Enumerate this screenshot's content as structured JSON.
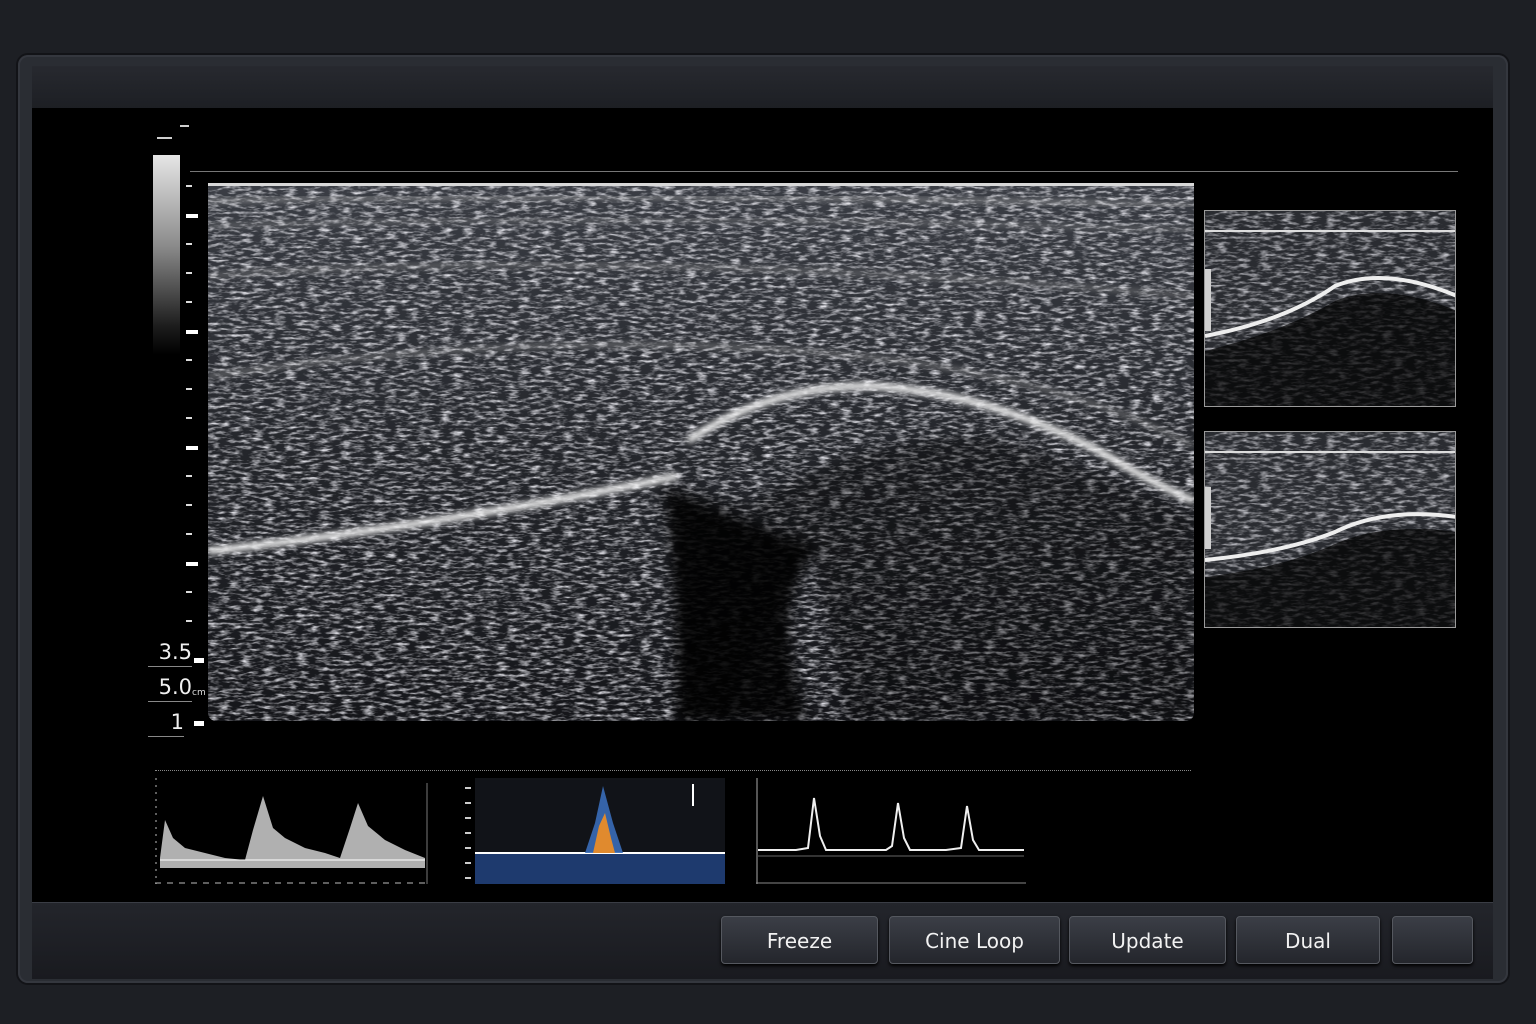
{
  "depth_params": [
    {
      "value": "3.5"
    },
    {
      "value": "5.0",
      "unit": "cm"
    },
    {
      "value": "1"
    }
  ],
  "buttons": {
    "freeze": "Freeze",
    "cine_loop": "Cine Loop",
    "update": "Update",
    "dual": "Dual",
    "blank": ""
  },
  "colors": {
    "doppler_blue": "#1e3a6e",
    "doppler_orange": "#e08a2e",
    "button_bg": "#2e3138"
  },
  "icons": [
    "grayscale-bar",
    "depth-ruler"
  ]
}
